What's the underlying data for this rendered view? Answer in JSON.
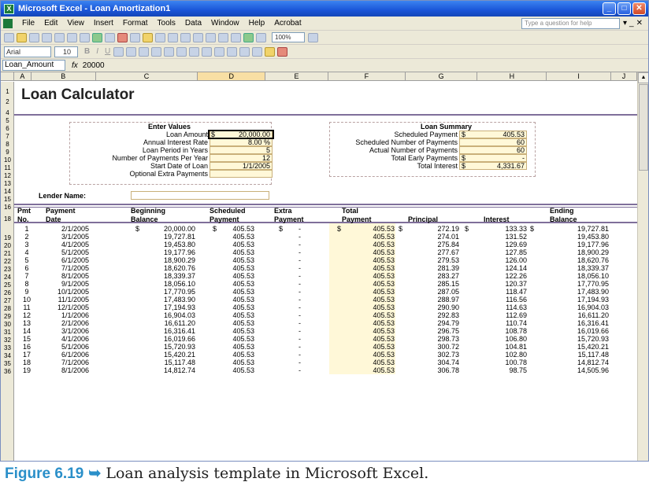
{
  "window": {
    "title": "Microsoft Excel - Loan Amortization1"
  },
  "menu": {
    "items": [
      "File",
      "Edit",
      "View",
      "Insert",
      "Format",
      "Tools",
      "Data",
      "Window",
      "Help",
      "Acrobat"
    ],
    "ask_placeholder": "Type a question for help"
  },
  "toolbar": {
    "zoom": "100%",
    "font": "Arial",
    "size": "10"
  },
  "formula_bar": {
    "name_box": "Loan_Amount",
    "fx": "fx",
    "formula": "20000"
  },
  "columns": [
    "A",
    "B",
    "C",
    "D",
    "E",
    "F",
    "G",
    "H",
    "I",
    "J"
  ],
  "rows": [
    "1",
    "2",
    "4",
    "5",
    "6",
    "7",
    "8",
    "9",
    "10",
    "11",
    "12",
    "13",
    "14",
    "15",
    "16",
    "18",
    "19",
    "20",
    "21",
    "22",
    "23",
    "24",
    "25",
    "26",
    "27",
    "28",
    "29",
    "30",
    "31",
    "32",
    "33",
    "34",
    "35",
    "36"
  ],
  "sheet": {
    "title": "Loan Calculator",
    "enter_values": {
      "heading": "Enter Values",
      "rows": [
        {
          "label": "Loan Amount",
          "dollar": "$",
          "value": "20,000.00"
        },
        {
          "label": "Annual Interest Rate",
          "dollar": "",
          "value": "8.00 %"
        },
        {
          "label": "Loan Period in Years",
          "dollar": "",
          "value": "5"
        },
        {
          "label": "Number of Payments Per Year",
          "dollar": "",
          "value": "12"
        },
        {
          "label": "Start Date of Loan",
          "dollar": "",
          "value": "1/1/2005"
        },
        {
          "label": "Optional Extra Payments",
          "dollar": "",
          "value": ""
        }
      ]
    },
    "loan_summary": {
      "heading": "Loan Summary",
      "rows": [
        {
          "label": "Scheduled Payment",
          "dollar": "$",
          "value": "405.53"
        },
        {
          "label": "Scheduled Number of Payments",
          "dollar": "",
          "value": "60"
        },
        {
          "label": "Actual Number of Payments",
          "dollar": "",
          "value": "60"
        },
        {
          "label": "Total Early Payments",
          "dollar": "$",
          "value": "-"
        },
        {
          "label": "Total Interest",
          "dollar": "$",
          "value": "4,331.67"
        }
      ]
    },
    "lender_label": "Lender Name:",
    "table": {
      "headers": [
        [
          "Pmt",
          "No."
        ],
        [
          "Payment",
          "Date"
        ],
        [
          "Beginning",
          "Balance"
        ],
        [
          "Scheduled",
          "Payment"
        ],
        [
          "Extra",
          "Payment"
        ],
        [
          "Total",
          "Payment"
        ],
        [
          "",
          "Principal"
        ],
        [
          "",
          "Interest"
        ],
        [
          "Ending",
          "Balance"
        ]
      ],
      "rows": [
        [
          "1",
          "2/1/2005",
          "20,000.00",
          "405.53",
          "-",
          "405.53",
          "272.19",
          "133.33",
          "19,727.81"
        ],
        [
          "2",
          "3/1/2005",
          "19,727.81",
          "405.53",
          "-",
          "405.53",
          "274.01",
          "131.52",
          "19,453.80"
        ],
        [
          "3",
          "4/1/2005",
          "19,453.80",
          "405.53",
          "-",
          "405.53",
          "275.84",
          "129.69",
          "19,177.96"
        ],
        [
          "4",
          "5/1/2005",
          "19,177.96",
          "405.53",
          "-",
          "405.53",
          "277.67",
          "127.85",
          "18,900.29"
        ],
        [
          "5",
          "6/1/2005",
          "18,900.29",
          "405.53",
          "-",
          "405.53",
          "279.53",
          "126.00",
          "18,620.76"
        ],
        [
          "6",
          "7/1/2005",
          "18,620.76",
          "405.53",
          "-",
          "405.53",
          "281.39",
          "124.14",
          "18,339.37"
        ],
        [
          "7",
          "8/1/2005",
          "18,339.37",
          "405.53",
          "-",
          "405.53",
          "283.27",
          "122.26",
          "18,056.10"
        ],
        [
          "8",
          "9/1/2005",
          "18,056.10",
          "405.53",
          "-",
          "405.53",
          "285.15",
          "120.37",
          "17,770.95"
        ],
        [
          "9",
          "10/1/2005",
          "17,770.95",
          "405.53",
          "-",
          "405.53",
          "287.05",
          "118.47",
          "17,483.90"
        ],
        [
          "10",
          "11/1/2005",
          "17,483.90",
          "405.53",
          "-",
          "405.53",
          "288.97",
          "116.56",
          "17,194.93"
        ],
        [
          "11",
          "12/1/2005",
          "17,194.93",
          "405.53",
          "-",
          "405.53",
          "290.90",
          "114.63",
          "16,904.03"
        ],
        [
          "12",
          "1/1/2006",
          "16,904.03",
          "405.53",
          "-",
          "405.53",
          "292.83",
          "112.69",
          "16,611.20"
        ],
        [
          "13",
          "2/1/2006",
          "16,611.20",
          "405.53",
          "-",
          "405.53",
          "294.79",
          "110.74",
          "16,316.41"
        ],
        [
          "14",
          "3/1/2006",
          "16,316.41",
          "405.53",
          "-",
          "405.53",
          "296.75",
          "108.78",
          "16,019.66"
        ],
        [
          "15",
          "4/1/2006",
          "16,019.66",
          "405.53",
          "-",
          "405.53",
          "298.73",
          "106.80",
          "15,720.93"
        ],
        [
          "16",
          "5/1/2006",
          "15,720.93",
          "405.53",
          "-",
          "405.53",
          "300.72",
          "104.81",
          "15,420.21"
        ],
        [
          "17",
          "6/1/2006",
          "15,420.21",
          "405.53",
          "-",
          "405.53",
          "302.73",
          "102.80",
          "15,117.48"
        ],
        [
          "18",
          "7/1/2006",
          "15,117.48",
          "405.53",
          "-",
          "405.53",
          "304.74",
          "100.78",
          "14,812.74"
        ],
        [
          "19",
          "8/1/2006",
          "14,812.74",
          "405.53",
          "-",
          "405.53",
          "306.78",
          "98.75",
          "14,505.96"
        ]
      ],
      "first_row_dollar": "$"
    }
  },
  "caption": {
    "label": "Figure 6.19",
    "arrow": "➥",
    "text": "Loan analysis template in Microsoft Excel."
  }
}
